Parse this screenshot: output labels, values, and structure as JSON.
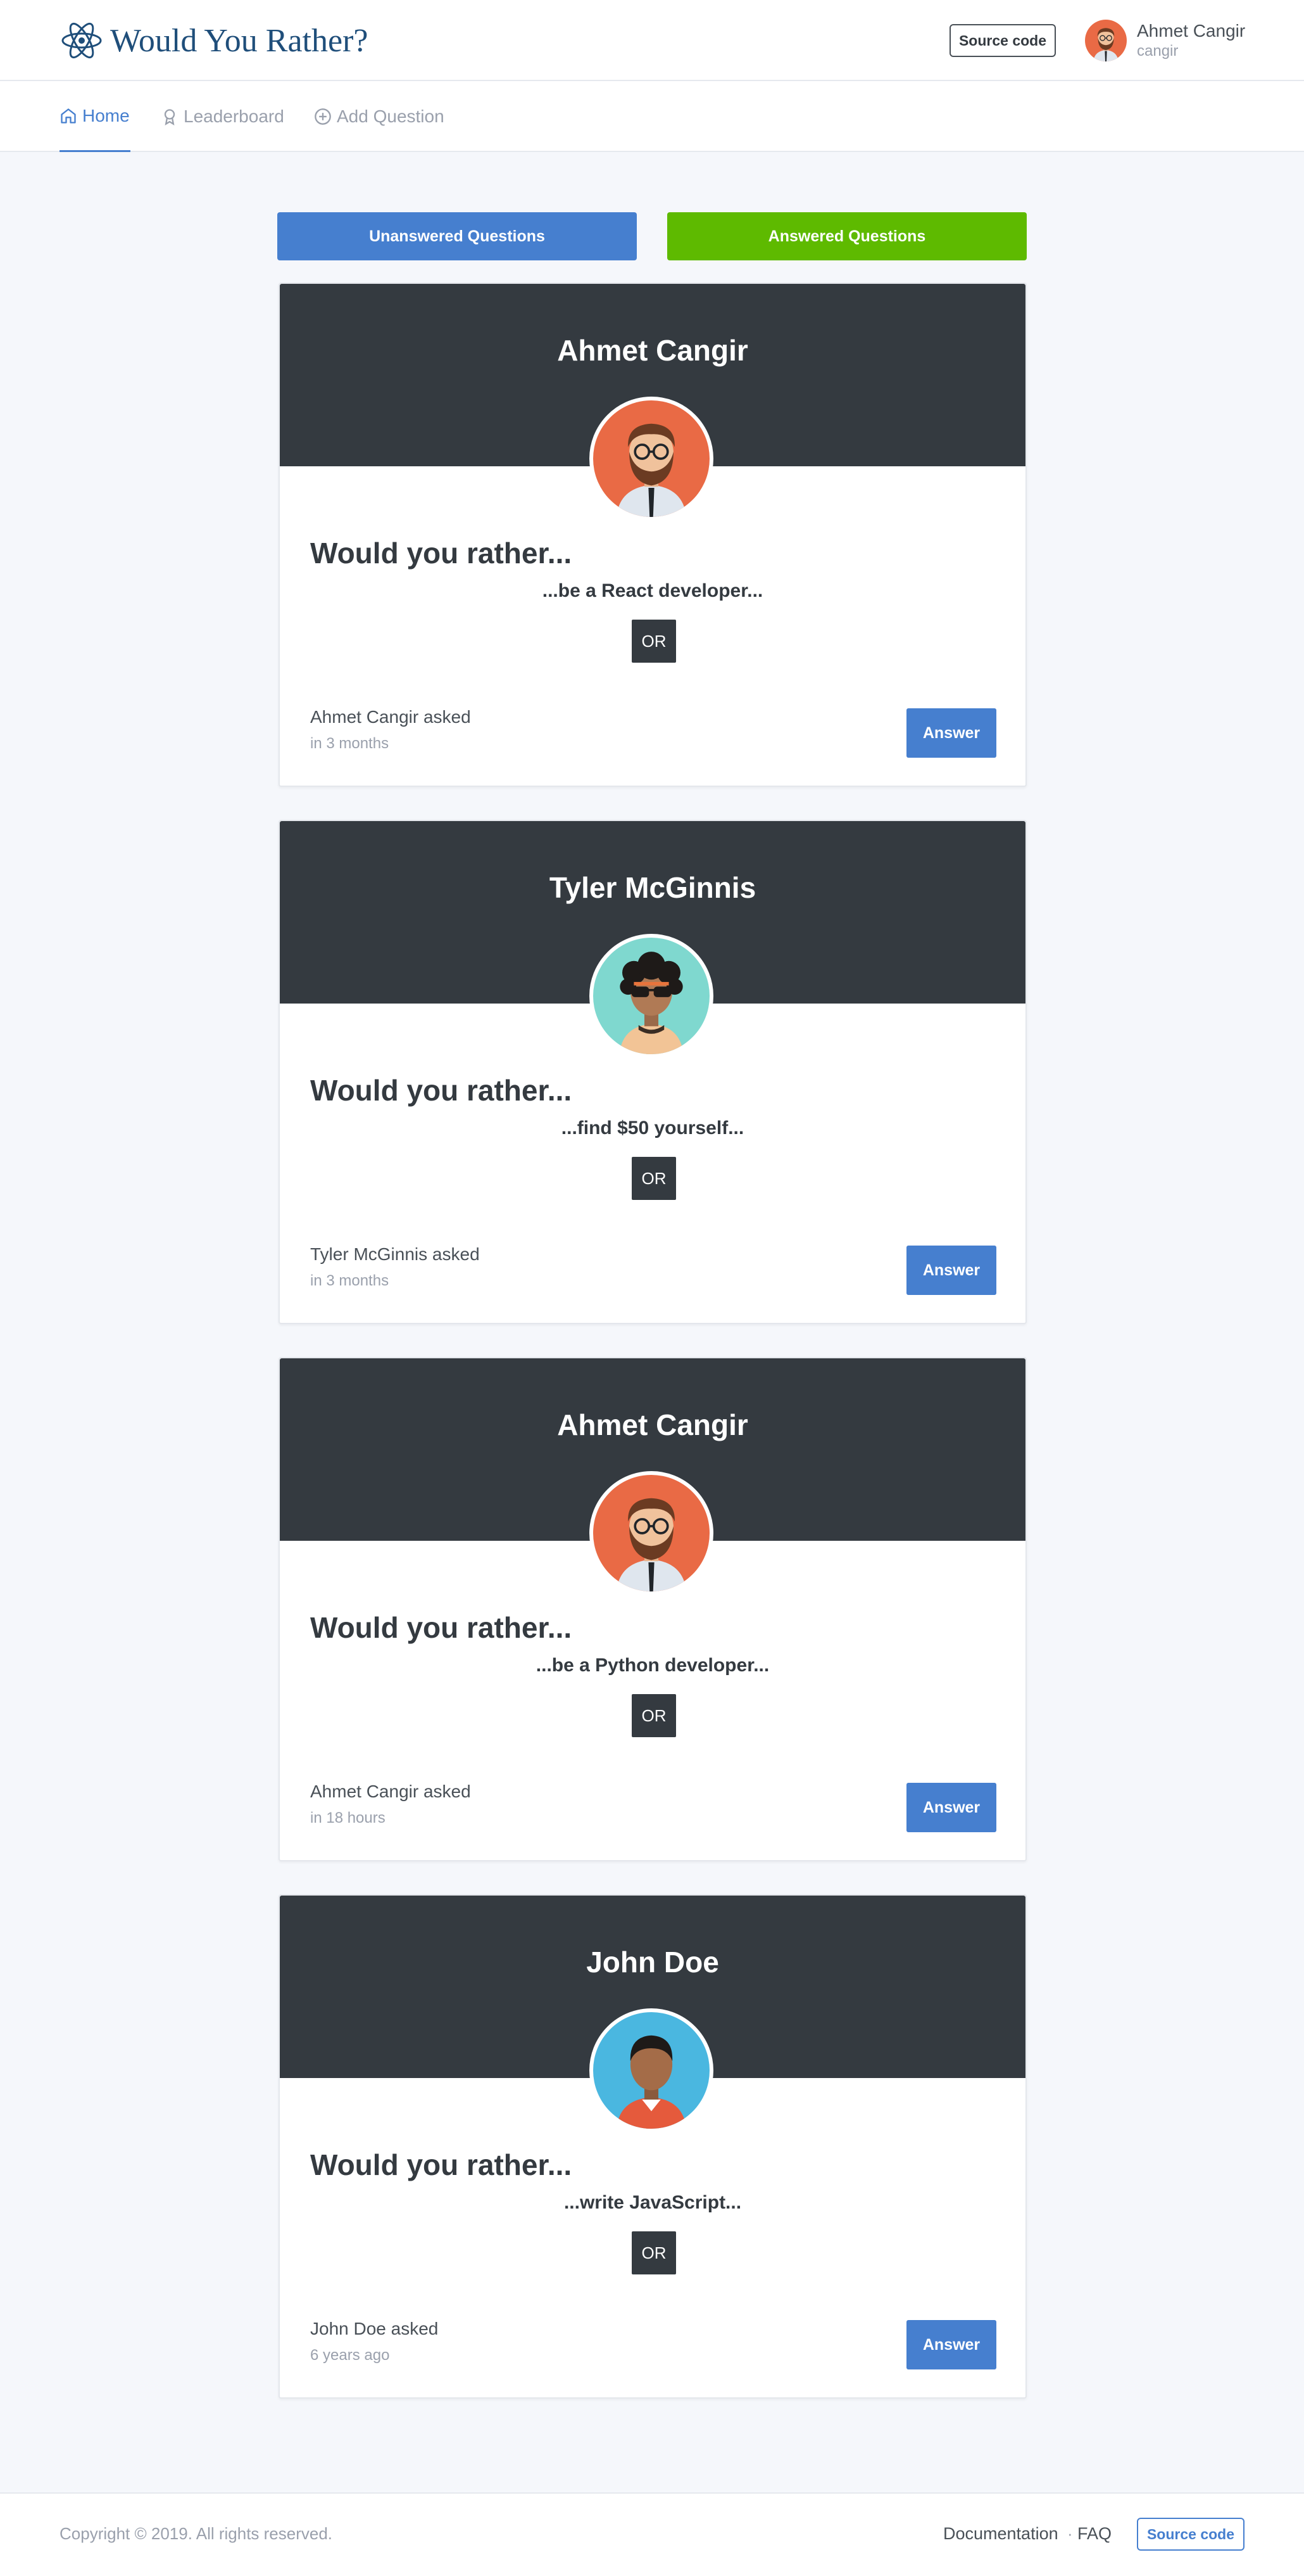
{
  "header": {
    "title": "Would You Rather?",
    "logo_icon": "react-atom-icon",
    "source_code_label": "Source code",
    "user": {
      "name": "Ahmet Cangir",
      "handle": "cangir",
      "avatar": "bearded-man-avatar"
    }
  },
  "nav": {
    "items": [
      {
        "label": "Home",
        "icon": "home-icon",
        "active": true
      },
      {
        "label": "Leaderboard",
        "icon": "award-icon",
        "active": false
      },
      {
        "label": "Add Question",
        "icon": "plus-circle-icon",
        "active": false
      }
    ]
  },
  "tabs": {
    "unanswered_label": "Unanswered Questions",
    "answered_label": "Answered Questions"
  },
  "questions": [
    {
      "author": "Ahmet Cangir",
      "avatar": "bearded-man-avatar",
      "heading": "Would you rather...",
      "option": "...be a React developer...",
      "or_label": "OR",
      "asked": "Ahmet Cangir asked",
      "time": "in 3 months",
      "answer_label": "Answer"
    },
    {
      "author": "Tyler McGinnis",
      "avatar": "curly-hair-sunglasses-avatar",
      "heading": "Would you rather...",
      "option": "...find $50 yourself...",
      "or_label": "OR",
      "asked": "Tyler McGinnis asked",
      "time": "in 3 months",
      "answer_label": "Answer"
    },
    {
      "author": "Ahmet Cangir",
      "avatar": "bearded-man-avatar",
      "heading": "Would you rather...",
      "option": "...be a Python developer...",
      "or_label": "OR",
      "asked": "Ahmet Cangir asked",
      "time": "in 18 hours",
      "answer_label": "Answer"
    },
    {
      "author": "John Doe",
      "avatar": "man-orange-shirt-avatar",
      "heading": "Would you rather...",
      "option": "...write JavaScript...",
      "or_label": "OR",
      "asked": "John Doe asked",
      "time": "6 years ago",
      "answer_label": "Answer"
    }
  ],
  "footer": {
    "copyright": "Copyright © 2019. All rights reserved.",
    "documentation_label": "Documentation",
    "separator": "·",
    "faq_label": "FAQ",
    "source_code_label": "Source code"
  },
  "colors": {
    "primary": "#467fcf",
    "success": "#5eba00",
    "dark": "#343a40",
    "background": "#f5f7fb"
  }
}
